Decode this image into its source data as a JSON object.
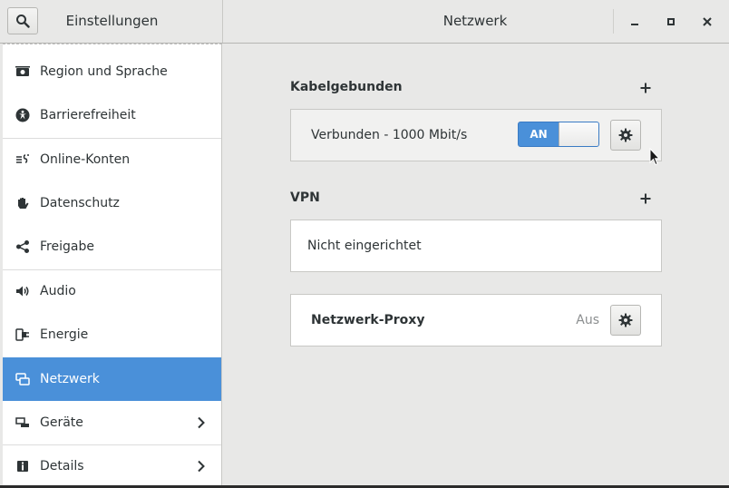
{
  "header": {
    "left_title": "Einstellungen",
    "right_title": "Netzwerk"
  },
  "sidebar": {
    "items": [
      {
        "label": "Region und Sprache",
        "icon": "globe-icon"
      },
      {
        "label": "Barrierefreiheit",
        "icon": "accessibility-icon"
      },
      {
        "label": "Online-Konten",
        "icon": "online-accounts-icon"
      },
      {
        "label": "Datenschutz",
        "icon": "hand-icon"
      },
      {
        "label": "Freigabe",
        "icon": "share-icon"
      },
      {
        "label": "Audio",
        "icon": "speaker-icon"
      },
      {
        "label": "Energie",
        "icon": "power-plug-icon"
      },
      {
        "label": "Netzwerk",
        "icon": "network-icon",
        "active": true
      },
      {
        "label": "Geräte",
        "icon": "devices-icon",
        "has_submenu": true
      },
      {
        "label": "Details",
        "icon": "info-icon",
        "has_submenu": true
      }
    ]
  },
  "wired": {
    "title": "Kabelgebunden",
    "status": "Verbunden - 1000 Mbit/s",
    "toggle_label": "AN"
  },
  "vpn": {
    "title": "VPN",
    "empty_text": "Nicht eingerichtet"
  },
  "proxy": {
    "title": "Netzwerk-Proxy",
    "status": "Aus"
  },
  "colors": {
    "accent": "#4a90d9",
    "background": "#e8e8e7",
    "text": "#2e3436"
  }
}
